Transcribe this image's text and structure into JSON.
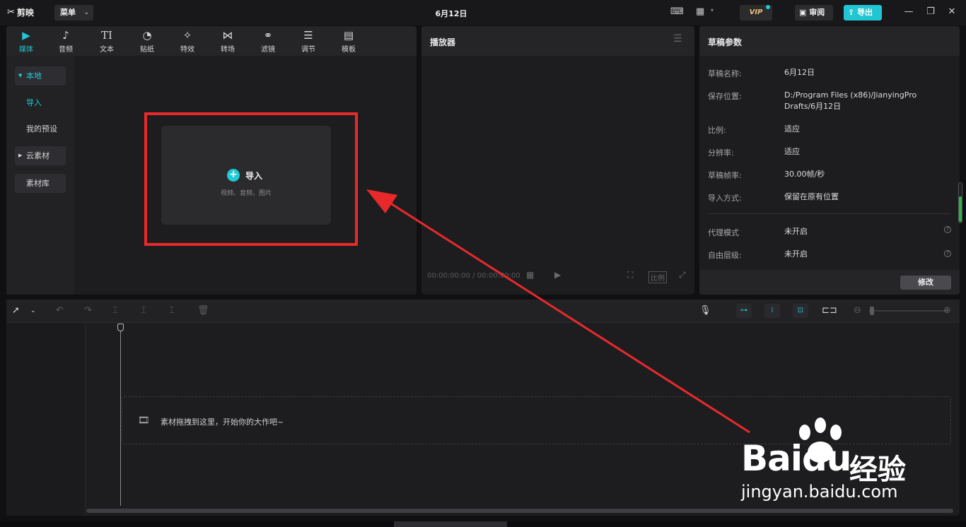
{
  "app": {
    "logo_text": "剪映",
    "menu_label": "菜单",
    "document_title": "6月12日",
    "vip_label": "VIP",
    "review_label": "审阅",
    "export_label": "导出"
  },
  "media": {
    "tabs": [
      {
        "label": "媒体",
        "icon": "media-icon",
        "active": true
      },
      {
        "label": "音频",
        "icon": "audio-icon"
      },
      {
        "label": "文本",
        "icon": "text-icon"
      },
      {
        "label": "贴纸",
        "icon": "sticker-icon"
      },
      {
        "label": "特效",
        "icon": "effects-icon"
      },
      {
        "label": "转场",
        "icon": "transition-icon"
      },
      {
        "label": "滤镜",
        "icon": "filter-icon"
      },
      {
        "label": "调节",
        "icon": "adjust-icon"
      },
      {
        "label": "模板",
        "icon": "template-icon"
      }
    ],
    "sidebar": {
      "local": "本地",
      "import": "导入",
      "presets": "我的预设",
      "cloud": "云素材",
      "library": "素材库"
    },
    "import_card": {
      "label": "导入",
      "hint": "视频、音频、图片"
    }
  },
  "player": {
    "title": "播放器",
    "timecode": "00:00:00:00 / 00:00:00:00",
    "ratio_label": "比例"
  },
  "draft": {
    "title": "草稿参数",
    "props": [
      {
        "key": "草稿名称:",
        "value": "6月12日"
      },
      {
        "key": "保存位置:",
        "value": "D:/Program Files (x86)/JianyingPro Drafts/6月12日"
      },
      {
        "key": "比例:",
        "value": "适应"
      },
      {
        "key": "分辨率:",
        "value": "适应"
      },
      {
        "key": "草稿帧率:",
        "value": "30.00帧/秒"
      },
      {
        "key": "导入方式:",
        "value": "保留在原有位置"
      },
      {
        "key": "代理模式",
        "value": "未开启"
      },
      {
        "key": "自由层级:",
        "value": "未开启"
      }
    ],
    "modify_label": "修改"
  },
  "timeline": {
    "drop_text": "素材拖拽到这里，开始你的大作吧~"
  },
  "watermark": {
    "brand": "Baidu",
    "brand_cn": "经验",
    "url": "jingyan.baidu.com"
  },
  "colors": {
    "accent": "#21c8d5",
    "highlight_box": "#e8292b",
    "background": "#1d1d20"
  }
}
